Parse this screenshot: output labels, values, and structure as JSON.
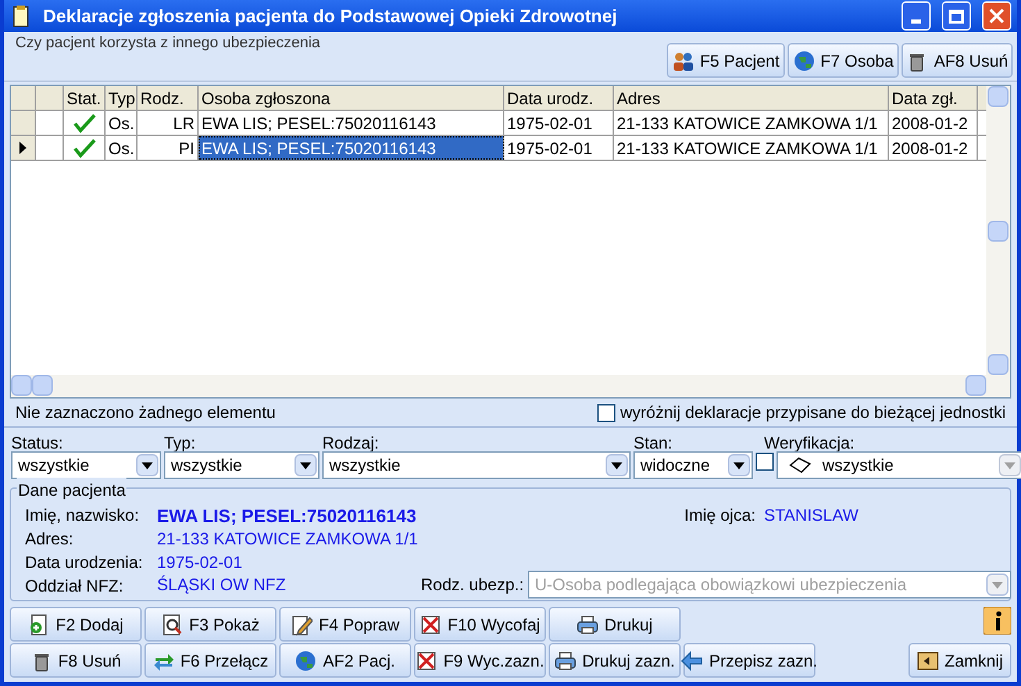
{
  "window": {
    "title": "Deklaracje zgłoszenia pacjenta do Podstawowej Opieki Zdrowotnej"
  },
  "insurance_group": {
    "label": "Czy pacjent korzysta z innego ubezpieczenia"
  },
  "top_buttons": [
    {
      "label": "F5 Pacjent"
    },
    {
      "label": "F7 Osoba"
    },
    {
      "label": "AF8 Usuń"
    }
  ],
  "table": {
    "columns": [
      "Stat.",
      "Typ",
      "Rodz.",
      "Osoba zgłoszona",
      "Data urodz.",
      "Adres",
      "Data zgł."
    ],
    "rows": [
      {
        "selected": false,
        "status_ok": true,
        "cells": [
          "",
          "Os.",
          "LR",
          "EWA LIS; PESEL:75020116143",
          "1975-02-01",
          "21-133 KATOWICE ZAMKOWA 1/1",
          "2008-01-2"
        ]
      },
      {
        "selected": true,
        "status_ok": true,
        "cells": [
          "",
          "Os.",
          "PI",
          "EWA LIS; PESEL:75020116143",
          "1975-02-01",
          "21-133 KATOWICE ZAMKOWA 1/1",
          "2008-01-2"
        ]
      }
    ]
  },
  "status_bar": {
    "message": "Nie zaznaczono żadnego elementu",
    "highlight_checkbox": {
      "label": "wyróżnij deklaracje przypisane do bieżącej jednostki",
      "checked": false
    }
  },
  "filters": [
    {
      "label": "Status:",
      "value": "wszystkie",
      "kind": "select"
    },
    {
      "label": "Typ:",
      "value": "wszystkie",
      "kind": "select"
    },
    {
      "label": "Rodzaj:",
      "value": "wszystkie",
      "kind": "select"
    },
    {
      "label": "Stan:",
      "value": "widoczne",
      "kind": "select"
    },
    {
      "label": "Weryfikacja:",
      "value": "wszystkie",
      "kind": "check_select",
      "checked": false
    }
  ],
  "patient": {
    "title": "Dane pacjenta",
    "name": {
      "label": "Imię, nazwisko:",
      "value": "EWA LIS; PESEL:75020116143"
    },
    "father": {
      "label": "Imię ojca:",
      "value": "STANISLAW"
    },
    "address": {
      "label": "Adres:",
      "value": "21-133 KATOWICE ZAMKOWA 1/1"
    },
    "birth": {
      "label": "Data urodzenia:",
      "value": "1975-02-01"
    },
    "branch": {
      "label": "Oddział NFZ:",
      "value": "ŚLĄSKI OW NFZ"
    },
    "insurance_type": {
      "label": "Rodz. ubezp.:",
      "value": "U-Osoba podlegająca obowiązkowi ubezpieczenia",
      "disabled": true
    }
  },
  "bottom_buttons": [
    [
      {
        "label": "F2 Dodaj"
      },
      {
        "label": "F3 Pokaż"
      },
      {
        "label": "F4 Popraw"
      },
      {
        "label": "F10 Wycofaj"
      },
      {
        "label": "Drukuj"
      }
    ],
    [
      {
        "label": "F8 Usuń"
      },
      {
        "label": "F6 Przełącz"
      },
      {
        "label": "AF2 Pacj."
      },
      {
        "label": "F9 Wyc.zazn."
      },
      {
        "label": "Drukuj zazn."
      },
      {
        "label": "Przepisz zazn."
      }
    ]
  ],
  "close_button": {
    "label": "Zamknij"
  }
}
